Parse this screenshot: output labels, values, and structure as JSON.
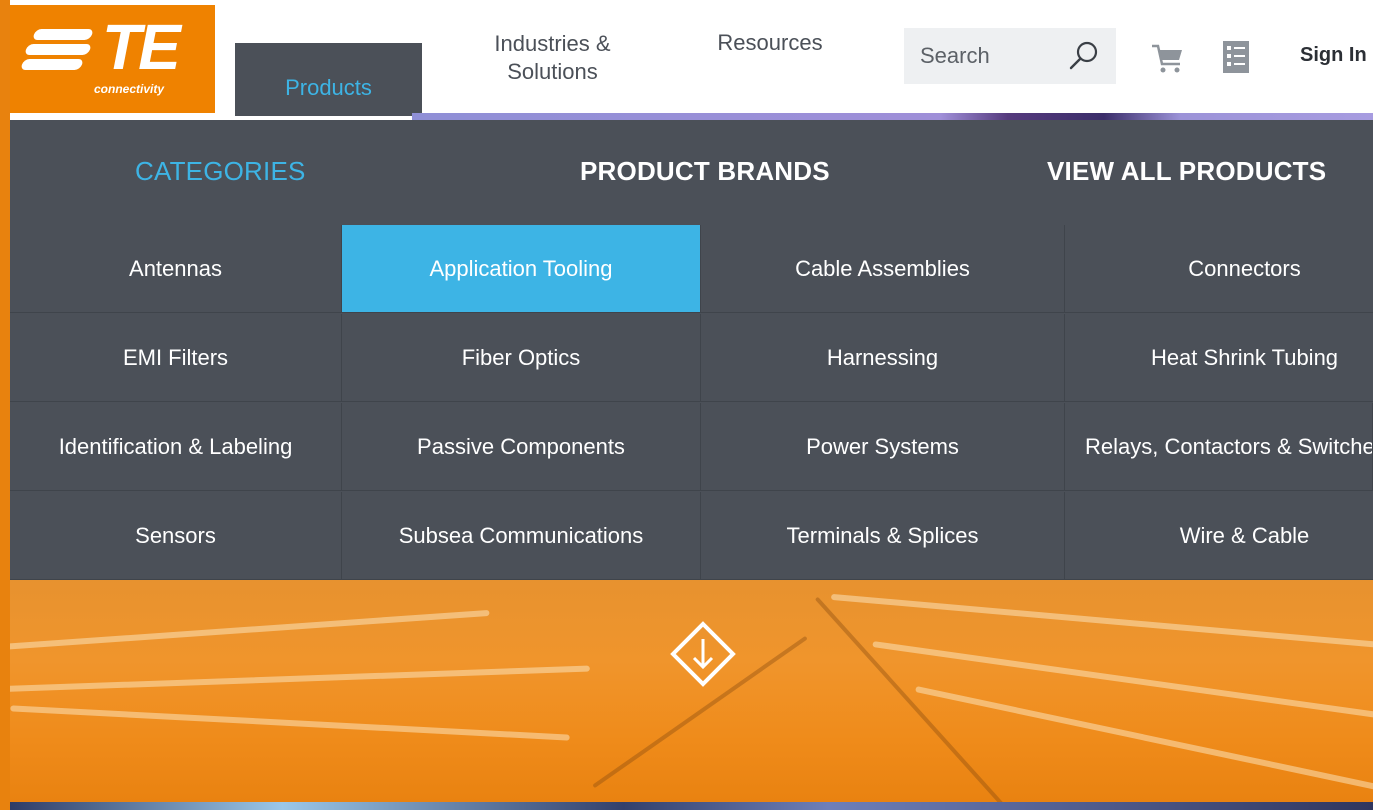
{
  "brand": {
    "logo_text": "TE",
    "logo_subtext": "connectivity",
    "color": "#ef8200"
  },
  "header": {
    "nav": {
      "products": "Products",
      "industries_line1": "Industries &",
      "industries_line2": "Solutions",
      "resources": "Resources"
    },
    "search": {
      "placeholder": "Search",
      "icon": "search-icon"
    },
    "cart_icon": "cart-icon",
    "list_icon": "checklist-icon",
    "sign_in": "Sign In"
  },
  "menu": {
    "tabs": [
      {
        "label": "CATEGORIES",
        "active": true
      },
      {
        "label": "PRODUCT BRANDS",
        "active": false
      },
      {
        "label": "VIEW ALL PRODUCTS",
        "active": false
      }
    ],
    "categories": [
      "Antennas",
      "Application Tooling",
      "Cable Assemblies",
      "Connectors",
      "EMI Filters",
      "Fiber Optics",
      "Harnessing",
      "Heat Shrink Tubing",
      "Identification & Labeling",
      "Passive Components",
      "Power Systems",
      "Relays, Contactors & Switches",
      "Sensors",
      "Subsea Communications",
      "Terminals & Splices",
      "Wire & Cable"
    ],
    "selected_category": "Application Tooling",
    "colors": {
      "background": "#4b5058",
      "accent": "#3db4e5"
    }
  },
  "hero": {
    "scroll_icon": "scroll-down-icon"
  }
}
